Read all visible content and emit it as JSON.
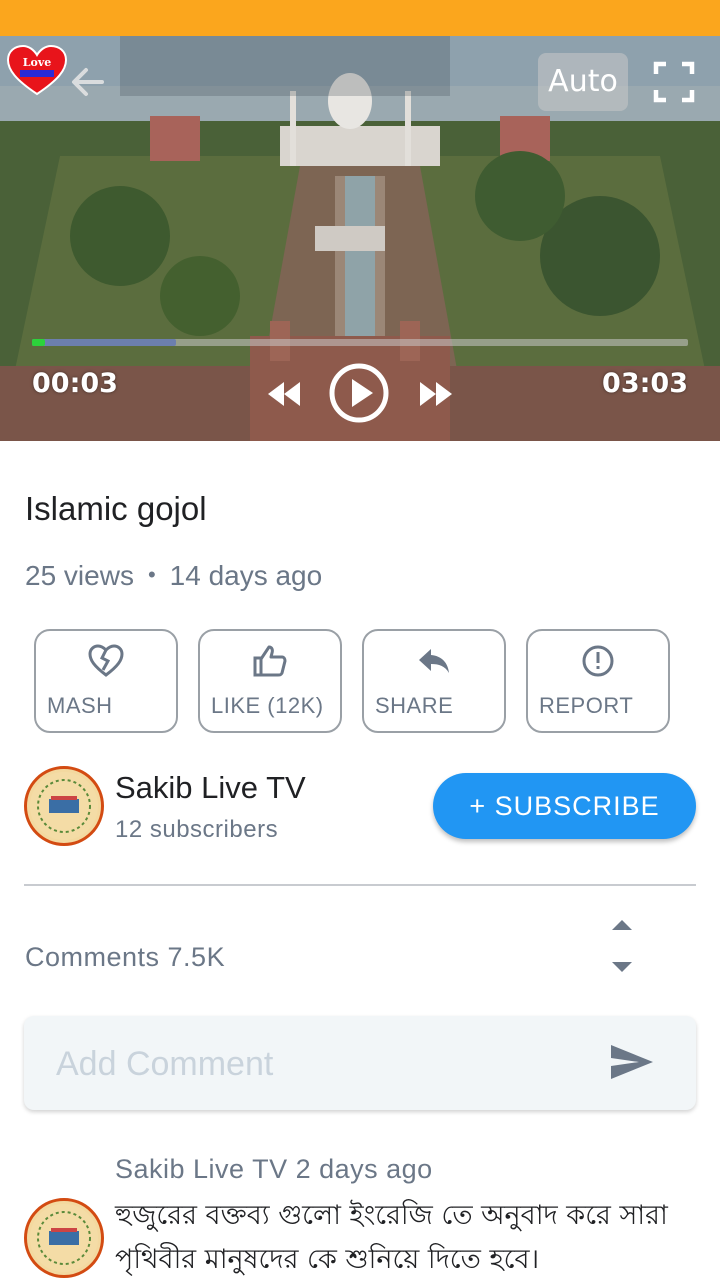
{
  "colors": {
    "status_bar": "#FBA61D",
    "accent": "#2196F3",
    "progress_played": "#2cd33b",
    "progress_buffer": "#6c7fae",
    "avatar_border": "#d34b12"
  },
  "player": {
    "logo_text": "Love",
    "auto_label": "Auto",
    "current_time": "00:03",
    "total_time": "03:03",
    "progress_played_fraction": 0.02,
    "progress_buffered_fraction": 0.22,
    "icons": {
      "back": "arrow-left-icon",
      "fullscreen": "fullscreen-icon",
      "rewind": "rewind-icon",
      "play": "play-icon",
      "forward": "fast-forward-icon"
    }
  },
  "video": {
    "title": "Islamic gojol",
    "views": "25 views",
    "posted": "14 days ago"
  },
  "actions": [
    {
      "label": "MASH",
      "icon": "broken-heart-icon"
    },
    {
      "label": "LIKE (12K)",
      "icon": "thumbs-up-icon"
    },
    {
      "label": "SHARE",
      "icon": "reply-icon"
    },
    {
      "label": "REPORT",
      "icon": "alert-icon"
    }
  ],
  "channel": {
    "name": "Sakib Live TV",
    "subscribers": "12 subscribers",
    "subscribe_label": "+  SUBSCRIBE"
  },
  "comments": {
    "label": "Comments 7.5K",
    "input_placeholder": "Add Comment",
    "items": [
      {
        "author_line": "Sakib Live TV 2 days ago",
        "text": "হুজুরের বক্তব্য গুলো ইংরেজি তে অনুবাদ করে সারা পৃথিবীর মানুষদের কে শুনিয়ে দিতে হবে।"
      }
    ]
  }
}
